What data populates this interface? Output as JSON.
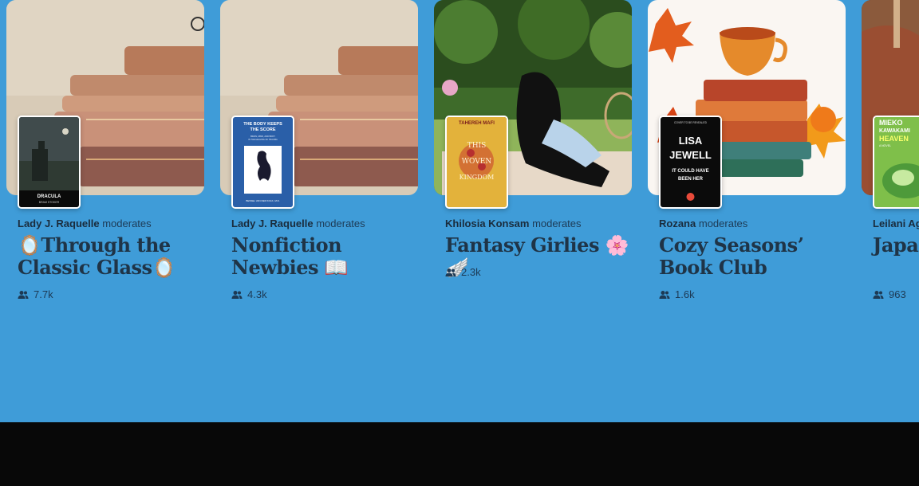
{
  "common": {
    "moderates_word": "moderates"
  },
  "clubs": [
    {
      "moderator": "Lady J. Raquelle",
      "title": "🪞Through the Classic Glass🪞",
      "members": "7.7k",
      "book": {
        "title": "DRACULA",
        "author": "BRAM STOKER"
      }
    },
    {
      "moderator": "Lady J. Raquelle",
      "title": "Nonfiction Newbies 📖",
      "members": "4.3k",
      "book": {
        "title": "THE BODY KEEPS THE SCORE",
        "subtitle": "BRAIN, MIND, AND BODY IN THE HEALING OF TRAUMA",
        "author": "BESSEL VAN DER KOLK, M.D."
      }
    },
    {
      "moderator": "Khilosia Konsam",
      "title": "Fantasy Girlies 🌸🪽",
      "members": "2.3k",
      "book": {
        "title": "THIS WOVEN KINGDOM",
        "author": "TAHEREH MAFI"
      }
    },
    {
      "moderator": "Rozana",
      "title": "Cozy Seasons’ Book Club",
      "members": "1.6k",
      "book": {
        "title": "LISA JEWELL",
        "subtitle": "IT COULD HAVE BEEN HER",
        "tag": "COVER TO BE REVEALED"
      }
    },
    {
      "moderator": "Leilani Agu",
      "title": "Japane 本の",
      "members": "963",
      "book": {
        "title": "MIEKO KAWAKAMI",
        "subtitle": "HEAVEN",
        "tag": "A NOVEL"
      }
    }
  ],
  "icons": {
    "members": "people-icon"
  },
  "colors": {
    "background": "#3f9cd8",
    "footer": "#080808",
    "text": "#1f3447"
  }
}
